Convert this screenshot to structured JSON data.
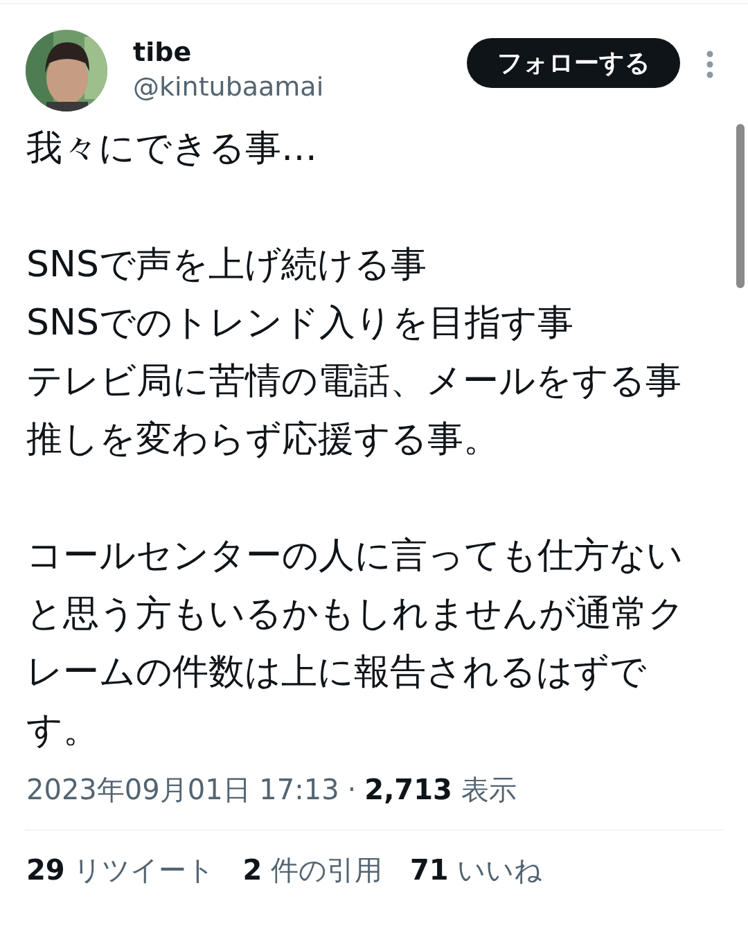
{
  "author": {
    "name": "tibe",
    "handle": "@kintubaamai"
  },
  "follow_button": {
    "label": "フォローする"
  },
  "tweet": {
    "paragraphs": [
      [
        "我々にできる事…"
      ],
      [
        "SNSで声を上げ続ける事",
        "SNSでのトレンド入りを目指す事",
        "テレビ局に苦情の電話、メールをする事",
        "推しを変わらず応援する事。"
      ],
      [
        "コールセンターの人に言っても仕方ないと思う方もいるかもしれませんが通常クレームの件数は上に報告されるはずです。"
      ]
    ]
  },
  "meta": {
    "timestamp": "2023年09月01日 17:13",
    "separator": "·",
    "views": "**2,713** 表示"
  },
  "stats": [
    {
      "text": "**29** リツイート"
    },
    {
      "text": "**2** 件の引用"
    },
    {
      "text": "**71** いいね"
    }
  ]
}
